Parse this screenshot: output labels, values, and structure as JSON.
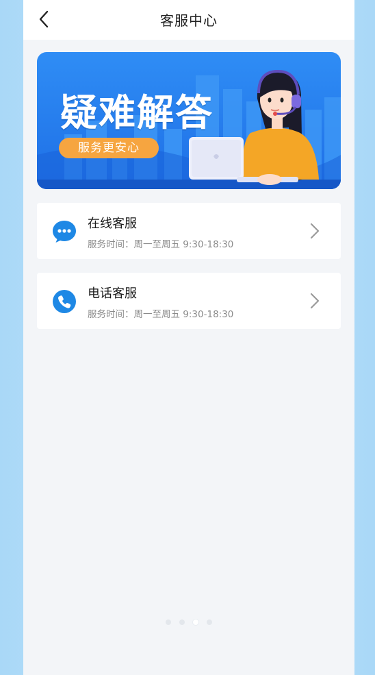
{
  "header": {
    "title": "客服中心",
    "back_icon": "chevron-left-icon"
  },
  "banner": {
    "title": "疑难解答",
    "tagline": "服务更安心",
    "colors": {
      "background": "#2f8df5",
      "pill": "#f6a540"
    }
  },
  "services": [
    {
      "name": "在线客服",
      "hours": "服务时间：周一至周五 9:30-18:30",
      "icon": "chat-bubble-icon"
    },
    {
      "name": "电话客服",
      "hours": "服务时间：周一至周五 9:30-18:30",
      "icon": "phone-icon"
    }
  ],
  "pagination": {
    "count": 4,
    "active_index": 2
  },
  "colors": {
    "accent": "#1e88e5",
    "background": "#f3f5f8",
    "side": "#a9d8f7"
  }
}
